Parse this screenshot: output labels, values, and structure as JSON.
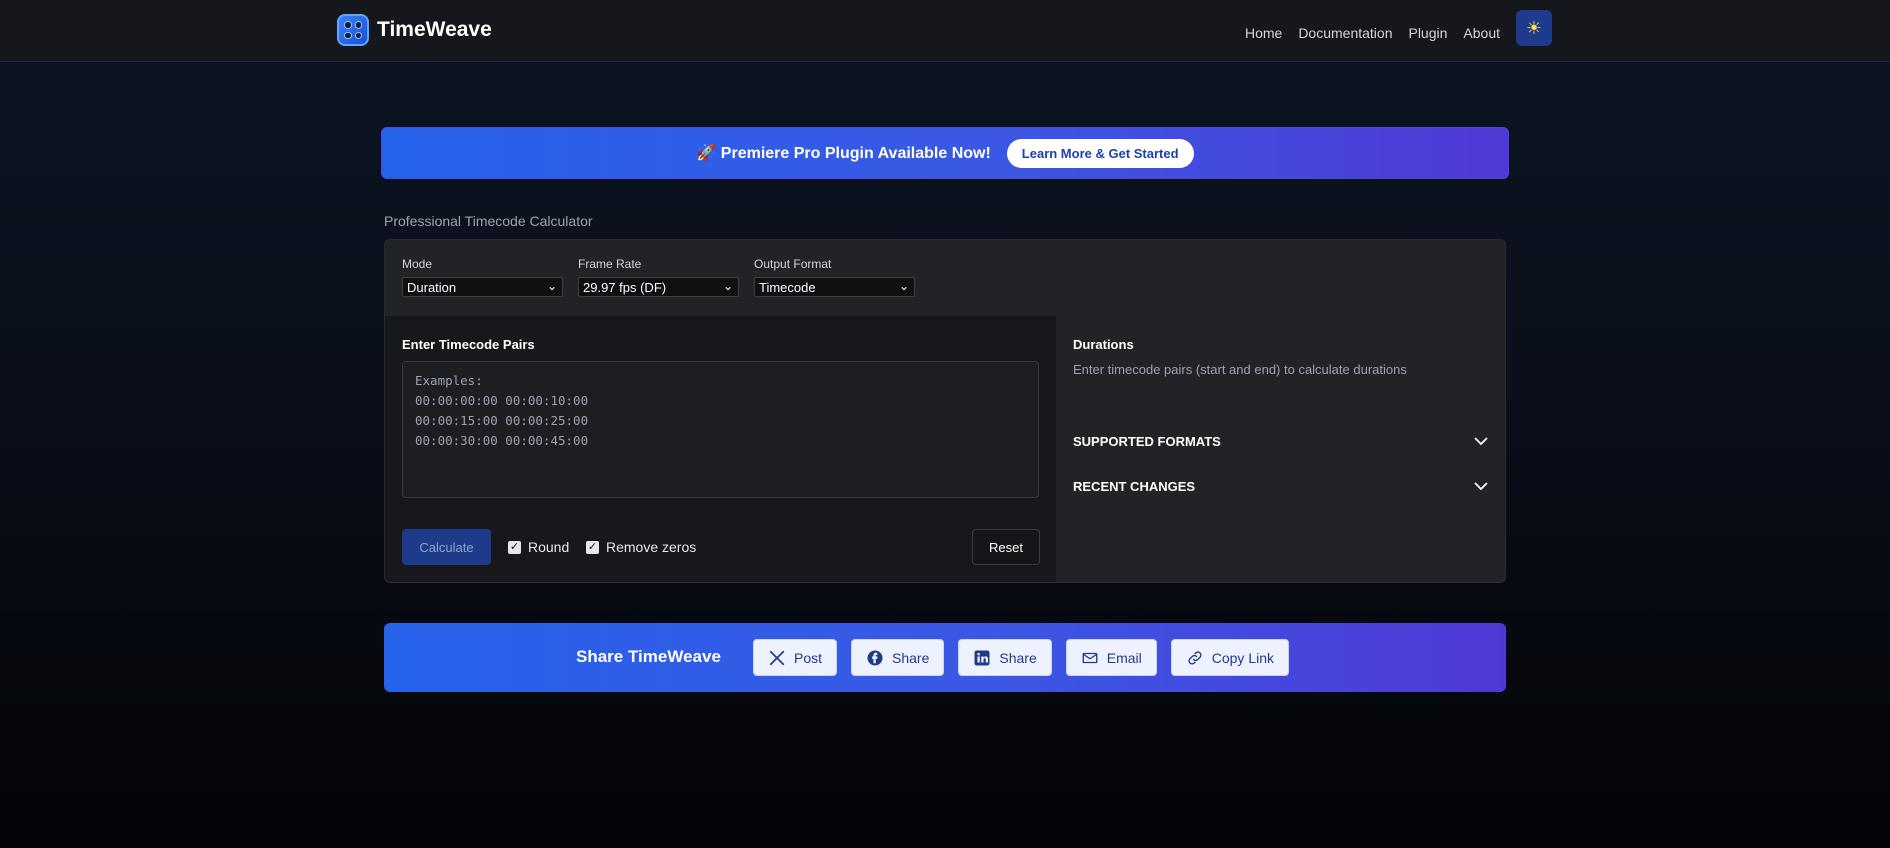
{
  "header": {
    "brand": "TimeWeave",
    "nav": [
      "Home",
      "Documentation",
      "Plugin",
      "About"
    ],
    "theme_icon": "sun-icon"
  },
  "promo": {
    "text": "🚀 Premiere Pro Plugin Available Now!",
    "button": "Learn More & Get Started"
  },
  "page": {
    "subtitle": "Professional Timecode Calculator"
  },
  "controls": {
    "mode_label": "Mode",
    "mode_value": "Duration",
    "frame_rate_label": "Frame Rate",
    "frame_rate_value": "29.97 fps (DF)",
    "output_format_label": "Output Format",
    "output_format_value": "Timecode"
  },
  "input": {
    "title": "Enter Timecode Pairs",
    "placeholder": "Examples:\n00:00:00:00 00:00:10:00\n00:00:15:00 00:00:25:00\n00:00:30:00 00:00:45:00",
    "calculate": "Calculate",
    "round_label": "Round",
    "round_checked": true,
    "remove_zeros_label": "Remove zeros",
    "remove_zeros_checked": true,
    "reset": "Reset"
  },
  "results": {
    "title": "Durations",
    "hint": "Enter timecode pairs (start and end) to calculate durations",
    "accordions": [
      "SUPPORTED FORMATS",
      "RECENT CHANGES"
    ]
  },
  "share": {
    "title": "Share TimeWeave",
    "buttons": [
      {
        "label": "Post",
        "icon": "x-icon"
      },
      {
        "label": "Share",
        "icon": "facebook-icon"
      },
      {
        "label": "Share",
        "icon": "linkedin-icon"
      },
      {
        "label": "Email",
        "icon": "email-icon"
      },
      {
        "label": "Copy Link",
        "icon": "link-icon"
      }
    ]
  },
  "colors": {
    "accent": "#2563eb",
    "gradient_end": "#4f39d6",
    "panel": "#222327",
    "input_panel": "#17181b"
  }
}
